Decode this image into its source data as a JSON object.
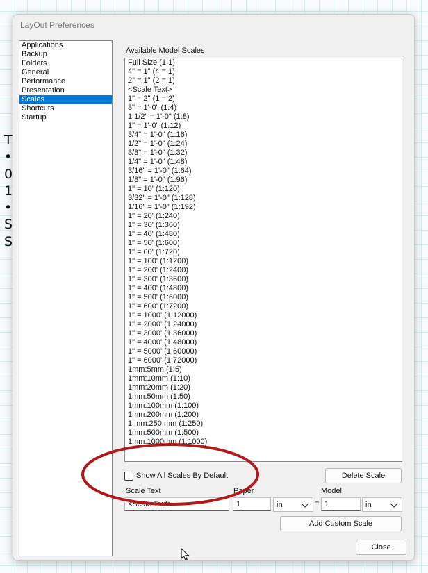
{
  "background_text": [
    "T",
    "•",
    "0",
    "1",
    "•",
    "S",
    "S"
  ],
  "window": {
    "title": "LayOut Preferences"
  },
  "nav": {
    "items": [
      "Applications",
      "Backup",
      "Folders",
      "General",
      "Performance",
      "Presentation",
      "Scales",
      "Shortcuts",
      "Startup"
    ],
    "selected": "Scales"
  },
  "scales": {
    "list_label": "Available Model Scales",
    "items": [
      "Full Size (1:1)",
      "4\" = 1\" (4 = 1)",
      "2\" = 1\" (2 = 1)",
      "<Scale Text>",
      "1\" = 2\" (1 = 2)",
      "3\" = 1'-0\" (1:4)",
      "1 1/2\" = 1'-0\" (1:8)",
      "1\" = 1'-0\" (1:12)",
      "3/4\" = 1'-0\" (1:16)",
      "1/2\" = 1'-0\" (1:24)",
      "3/8\" = 1'-0\" (1:32)",
      "1/4\" = 1'-0\" (1:48)",
      "3/16\" = 1'-0\" (1:64)",
      "1/8\" = 1'-0\" (1:96)",
      "1\" = 10' (1:120)",
      "3/32\" = 1'-0\" (1:128)",
      "1/16\" = 1'-0\" (1:192)",
      "1\" = 20' (1:240)",
      "1\" = 30' (1:360)",
      "1\" = 40' (1:480)",
      "1\" = 50' (1:600)",
      "1\" = 60' (1:720)",
      "1\" = 100' (1:1200)",
      "1\" = 200' (1:2400)",
      "1\" = 300' (1:3600)",
      "1\" = 400' (1:4800)",
      "1\" = 500' (1:6000)",
      "1\" = 600' (1:7200)",
      "1\" = 1000' (1:12000)",
      "1\" = 2000' (1:24000)",
      "1\" = 3000' (1:36000)",
      "1\" = 4000' (1:48000)",
      "1\" = 5000' (1:60000)",
      "1\" = 6000' (1:72000)",
      "1mm:5mm (1:5)",
      "1mm:10mm (1:10)",
      "1mm:20mm (1:20)",
      "1mm:50mm (1:50)",
      "1mm:100mm (1:100)",
      "1mm:200mm (1:200)",
      "1 mm:250 mm (1:250)",
      "1mm:500mm (1:500)",
      "1mm:1000mm (1:1000)"
    ],
    "show_all_label": "Show All Scales By Default",
    "show_all_checked": false,
    "delete_label": "Delete Scale",
    "scale_text_label": "Scale Text",
    "scale_text_value": "<Scale Text>",
    "paper_label": "Paper",
    "paper_value": "1",
    "paper_unit": "in",
    "equals": "=",
    "model_label": "Model",
    "model_value": "1",
    "model_unit": "in",
    "add_label": "Add Custom Scale",
    "close_label": "Close"
  },
  "colors": {
    "selection": "#0078d7",
    "annotation": "#b01a1a"
  }
}
